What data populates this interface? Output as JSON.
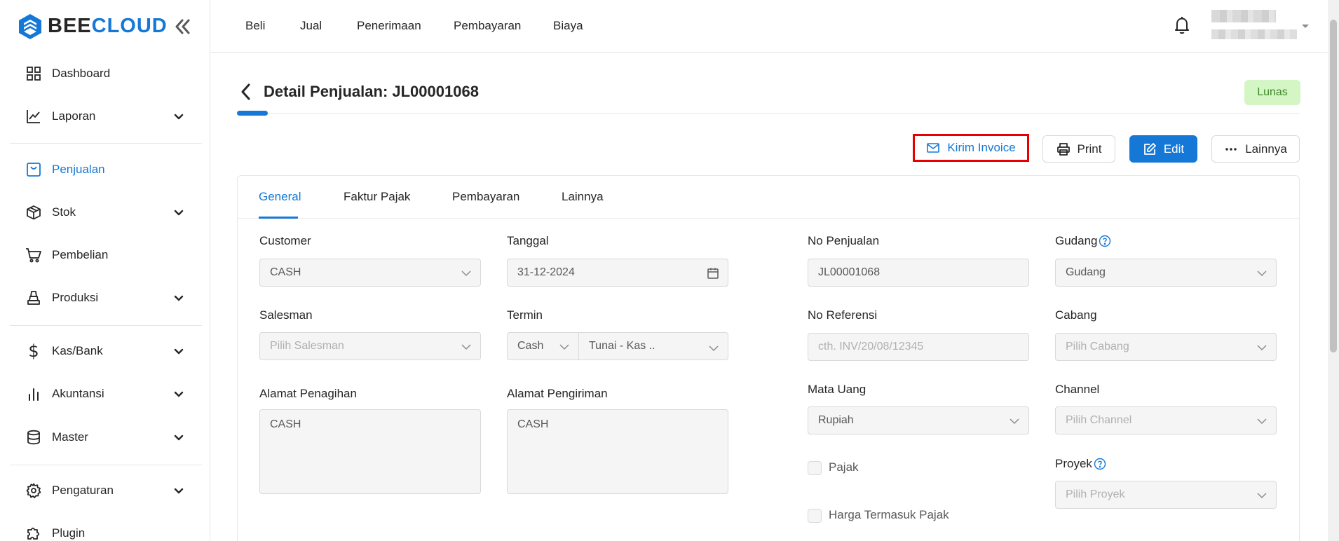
{
  "brand": {
    "name_part1": "BEE",
    "name_part2": "CLOUD",
    "accent": "#1578d6"
  },
  "sidebar": {
    "items": [
      {
        "label": "Dashboard",
        "icon": "dashboard-grid-icon"
      },
      {
        "label": "Laporan",
        "icon": "chart-line-icon"
      },
      {
        "label": "Penjualan",
        "icon": "sales-bag-icon"
      },
      {
        "label": "Stok",
        "icon": "box-icon"
      },
      {
        "label": "Pembelian",
        "icon": "cart-icon"
      },
      {
        "label": "Produksi",
        "icon": "factory-icon"
      },
      {
        "label": "Kas/Bank",
        "icon": "dollar-icon"
      },
      {
        "label": "Akuntansi",
        "icon": "bar-chart-icon"
      },
      {
        "label": "Master",
        "icon": "database-icon"
      },
      {
        "label": "Pengaturan",
        "icon": "gear-icon"
      },
      {
        "label": "Plugin",
        "icon": "puzzle-icon"
      }
    ]
  },
  "topnav": {
    "items": [
      {
        "label": "Beli"
      },
      {
        "label": "Jual"
      },
      {
        "label": "Penerimaan"
      },
      {
        "label": "Pembayaran"
      },
      {
        "label": "Biaya"
      }
    ]
  },
  "header": {
    "title": "Detail Penjualan: JL00001068",
    "status": "Lunas",
    "status_color": "#d4f5c4"
  },
  "actions": {
    "invoice": "Kirim Invoice",
    "print": "Print",
    "edit": "Edit",
    "more": "Lainnya"
  },
  "tabs": [
    {
      "label": "General"
    },
    {
      "label": "Faktur Pajak"
    },
    {
      "label": "Pembayaran"
    },
    {
      "label": "Lainnya"
    }
  ],
  "form": {
    "customer": {
      "label": "Customer",
      "value": "CASH"
    },
    "tanggal": {
      "label": "Tanggal",
      "value": "31-12-2024"
    },
    "no_penjualan": {
      "label": "No Penjualan",
      "value": "JL00001068"
    },
    "gudang": {
      "label": "Gudang",
      "value": "Gudang"
    },
    "salesman": {
      "label": "Salesman",
      "placeholder": "Pilih Salesman"
    },
    "termin": {
      "label": "Termin",
      "type_value": "Cash",
      "value": "Tunai - Kas .."
    },
    "no_referensi": {
      "label": "No Referensi",
      "placeholder": "cth. INV/20/08/12345"
    },
    "cabang": {
      "label": "Cabang",
      "placeholder": "Pilih Cabang"
    },
    "alamat_penagihan": {
      "label": "Alamat Penagihan",
      "value": "CASH"
    },
    "alamat_pengiriman": {
      "label": "Alamat Pengiriman",
      "value": "CASH"
    },
    "mata_uang": {
      "label": "Mata Uang",
      "value": "Rupiah"
    },
    "channel": {
      "label": "Channel",
      "placeholder": "Pilih Channel"
    },
    "pajak": {
      "label": "Pajak"
    },
    "harga_termasuk_pajak": {
      "label": "Harga Termasuk Pajak"
    },
    "proyek": {
      "label": "Proyek",
      "placeholder": "Pilih Proyek"
    }
  }
}
